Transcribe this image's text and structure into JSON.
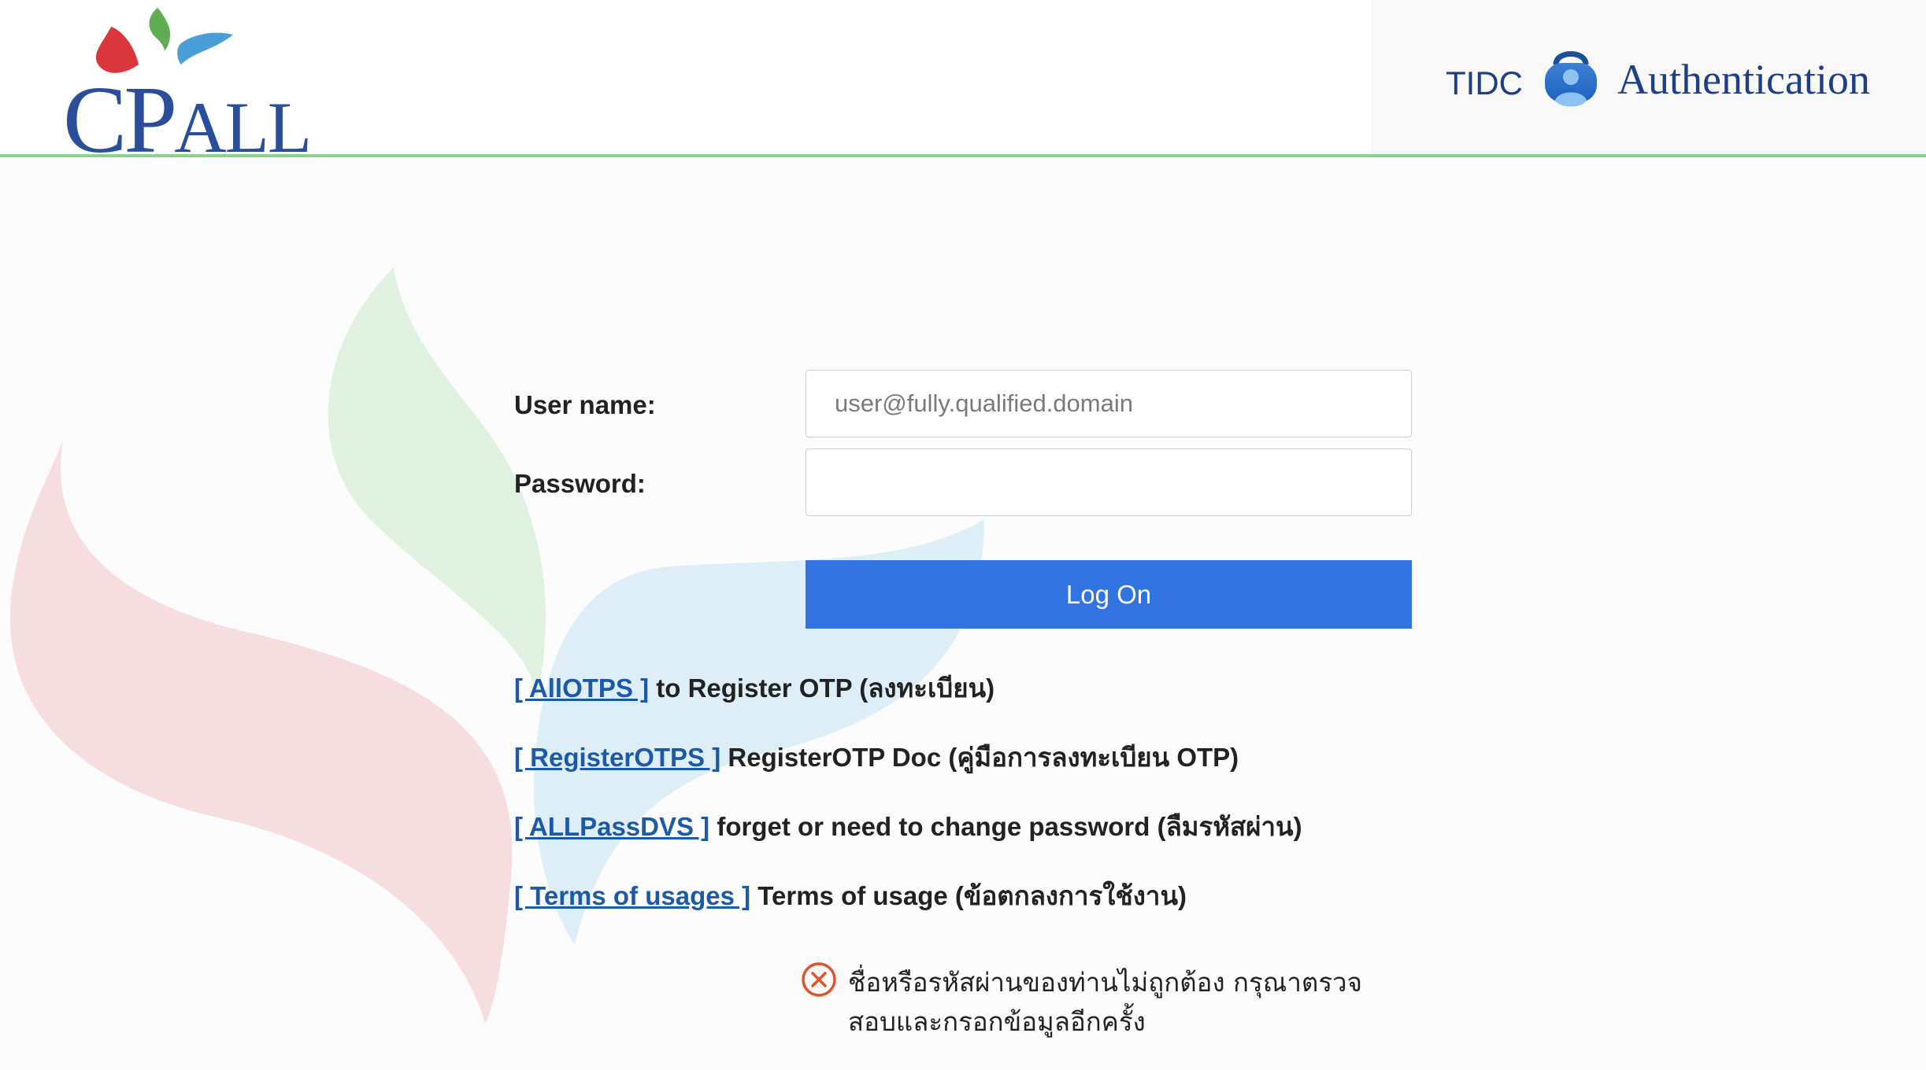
{
  "header": {
    "logo_text_big": "CP",
    "logo_text_small": "ALL",
    "org_label": "TIDC",
    "title": "Authentication",
    "accent_color": "#90cf8c",
    "brand_color": "#2a4e99"
  },
  "form": {
    "username_label": "User name:",
    "username_placeholder": "user@fully.qualified.domain",
    "username_value": "",
    "password_label": "Password:",
    "password_value": "",
    "submit_label": "Log On",
    "submit_color": "#3173e0"
  },
  "links": [
    {
      "link_text": "[ AllOTPS ]",
      "description": " to Register OTP (ลงทะเบียน)"
    },
    {
      "link_text": "[ RegisterOTPS ]",
      "description": " RegisterOTP Doc (คู่มือการลงทะเบียน OTP)"
    },
    {
      "link_text": "[ ALLPassDVS ]",
      "description": " forget or need to change password (ลืมรหัสผ่าน)"
    },
    {
      "link_text": "[ Terms of usages ]",
      "description": " Terms of usage (ข้อตกลงการใช้งาน)"
    }
  ],
  "error": {
    "icon": "error-circle-x-icon",
    "message": "ชื่อหรือรหัสผ่านของท่านไม่ถูกต้อง กรุณาตรวจสอบและกรอกข้อมูลอีกครั้ง",
    "color": "#e0532e"
  }
}
